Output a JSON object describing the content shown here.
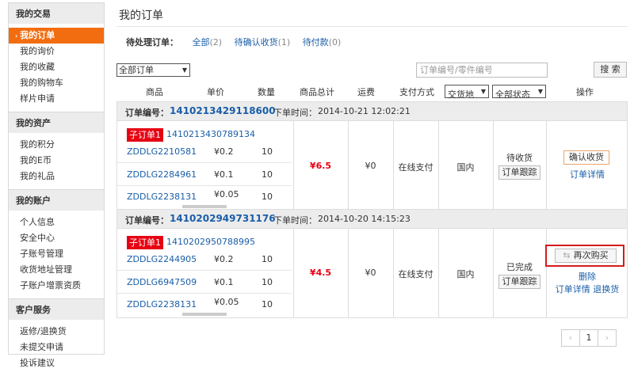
{
  "sidebar": {
    "groups": [
      {
        "title": "我的交易",
        "items": [
          "我的订单",
          "我的询价",
          "我的收藏",
          "我的购物车",
          "样片申请"
        ]
      },
      {
        "title": "我的资产",
        "items": [
          "我的积分",
          "我的E币",
          "我的礼品"
        ]
      },
      {
        "title": "我的账户",
        "items": [
          "个人信息",
          "安全中心",
          "子账号管理",
          "收货地址管理",
          "子账户增票资质"
        ]
      },
      {
        "title": "客户服务",
        "items": [
          "返修/退换货",
          "未提交申请",
          "投诉建议"
        ]
      }
    ],
    "active_arrow": "›"
  },
  "page": {
    "title": "我的订单"
  },
  "filters": {
    "label": "待处理订单：",
    "links": [
      {
        "text": "全部",
        "count": "(2)"
      },
      {
        "text": "待确认收货",
        "count": "(1)"
      },
      {
        "text": "待付款",
        "count": "(0)"
      }
    ]
  },
  "toolbar": {
    "order_filter": "全部订单",
    "search_placeholder": "订单编号/零件编号",
    "search_button": "搜 索"
  },
  "table_header": {
    "product": "商品",
    "unit_price": "单价",
    "qty": "数量",
    "total": "商品总计",
    "shipping": "运费",
    "payment": "支付方式",
    "region_select": "交货地",
    "status_select": "全部状态",
    "actions": "操作"
  },
  "orders": [
    {
      "label": "订单编号：",
      "number": "1410213429118600",
      "time_label": "下单时间：",
      "time": "2014-10-21 12:02:21",
      "sub_tag": "子订单1",
      "sub_number": "1410213430789134",
      "items": [
        {
          "part": "ZDDLG2210581",
          "price": "¥0.2",
          "qty": "10"
        },
        {
          "part": "ZDDLG2284961",
          "price": "¥0.1",
          "qty": "10"
        },
        {
          "part": "ZDDLG2238131",
          "price": "¥0.05",
          "qty": "10"
        }
      ],
      "total": "¥6.5",
      "shipping": "¥0",
      "payment": "在线支付",
      "region": "国内",
      "status": "待收货",
      "track": "订单跟踪",
      "action_button": "确认收货",
      "links": [
        "订单详情"
      ]
    },
    {
      "label": "订单编号：",
      "number": "1410202949731176",
      "time_label": "下单时间：",
      "time": "2014-10-20 14:15:23",
      "sub_tag": "子订单1",
      "sub_number": "1410202950788995",
      "items": [
        {
          "part": "ZDDLG2244905",
          "price": "¥0.2",
          "qty": "10"
        },
        {
          "part": "ZDDLG6947509",
          "price": "¥0.1",
          "qty": "10"
        },
        {
          "part": "ZDDLG2238131",
          "price": "¥0.05",
          "qty": "10"
        }
      ],
      "total": "¥4.5",
      "shipping": "¥0",
      "payment": "在线支付",
      "region": "国内",
      "status": "已完成",
      "track": "订单跟踪",
      "action_button": "再次购买",
      "action_icon": "⇆",
      "links": [
        "删除",
        "订单详情",
        "退换货"
      ]
    }
  ],
  "pager": {
    "prev": "‹",
    "current": "1",
    "next": "›"
  },
  "colors": {
    "accent": "#f26d10",
    "tag_red": "#e60012",
    "link": "#1a5ea8",
    "highlight_box": "#d41b1b"
  }
}
